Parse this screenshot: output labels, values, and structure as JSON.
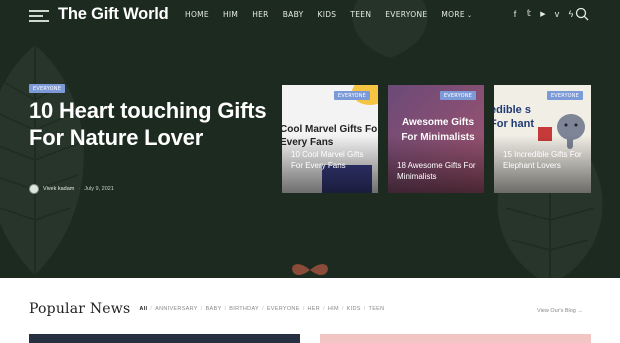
{
  "header": {
    "logo": "The Gift World",
    "nav": [
      {
        "label": "HOME"
      },
      {
        "label": "HIM"
      },
      {
        "label": "HER"
      },
      {
        "label": "BABY"
      },
      {
        "label": "KIDS"
      },
      {
        "label": "TEEN"
      },
      {
        "label": "EVERYONE"
      },
      {
        "label": "MORE"
      }
    ],
    "social": [
      {
        "icon": "facebook-icon",
        "glyph": "f"
      },
      {
        "icon": "twitter-icon",
        "glyph": "𝕥"
      },
      {
        "icon": "youtube-icon",
        "glyph": "▶"
      },
      {
        "icon": "vimeo-icon",
        "glyph": "v"
      },
      {
        "icon": "bolt-icon",
        "glyph": "ϟ"
      }
    ]
  },
  "featured": {
    "tag": "EVERYONE",
    "title": "10 Heart touching Gifts For Nature Lover",
    "author": "Vivek kadam",
    "date": "July 9, 2021"
  },
  "cards": [
    {
      "tag": "EVERYONE",
      "title": "10 Cool Marvel Gifts For Every Fans",
      "art_text": "Cool Marvel Gifts Fo Every Fans"
    },
    {
      "tag": "EVERYONE",
      "title": "18 Awesome Gifts For Minimalists",
      "art_text": "Awesome Gifts For Minimalists"
    },
    {
      "tag": "EVERYONE",
      "title": "15 Incredible Gifts For Elephant Lovers",
      "art_text": "edible s For hant"
    }
  ],
  "popular": {
    "title": "Popular News",
    "filters": [
      {
        "label": "All",
        "active": true
      },
      {
        "label": "ANNIVERSARY"
      },
      {
        "label": "BABY"
      },
      {
        "label": "BIRTHDAY"
      },
      {
        "label": "EVERYONE"
      },
      {
        "label": "HER"
      },
      {
        "label": "HIM"
      },
      {
        "label": "KIDS"
      },
      {
        "label": "TEEN"
      }
    ],
    "view_blog": "View Our's Blog →"
  },
  "colors": {
    "hero_bg": "#1d2a20",
    "tag_bg": "#7d9ad8"
  }
}
